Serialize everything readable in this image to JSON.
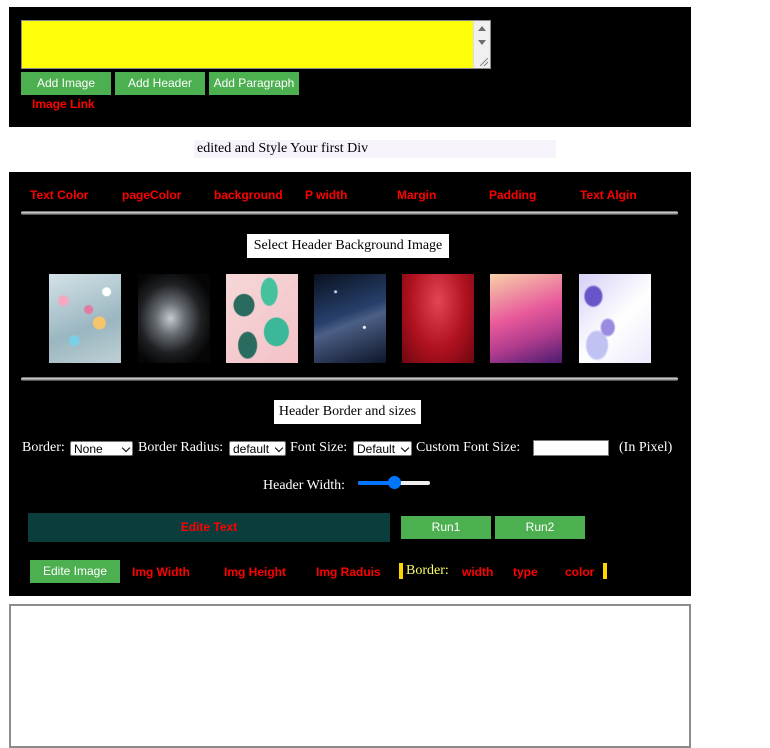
{
  "editor": {
    "buttons": {
      "add_image": "Add Image",
      "add_header": "Add Header",
      "add_paragraph": "Add Paragraph"
    },
    "image_link": "Image Link",
    "textarea_value": ""
  },
  "caption": "edited and Style Your first Div",
  "style_menu": [
    "Text Color",
    "pageColor",
    "background",
    "P width",
    "Margin",
    "Padding",
    "Text Algin"
  ],
  "header_bg": {
    "title": "Select Header Background Image",
    "thumbnails": [
      {
        "name": "bokeh-thumbnail",
        "colors": [
          "#c7d9df",
          "#9fb9c4",
          "#e8b3c6",
          "#7ea6b0"
        ]
      },
      {
        "name": "smoke-thumbnail",
        "colors": [
          "#0a0a0a",
          "#3b3f45",
          "#b7bcc1",
          "#1a1a1a"
        ]
      },
      {
        "name": "leaves-thumbnail",
        "colors": [
          "#f3c2c8",
          "#3bb897",
          "#2a6b5f",
          "#f6d7d7"
        ]
      },
      {
        "name": "galaxy-thumbnail",
        "colors": [
          "#0d1528",
          "#27406b",
          "#4c5f86",
          "#0a1020"
        ]
      },
      {
        "name": "red-thumbnail",
        "colors": [
          "#b0111f",
          "#d93240",
          "#6d0710",
          "#e44555"
        ]
      },
      {
        "name": "pink-gradient-thumbnail",
        "colors": [
          "#f7d0a8",
          "#e85a9b",
          "#b23c8e",
          "#4a1c6f"
        ]
      },
      {
        "name": "floral-thumbnail",
        "colors": [
          "#ffffff",
          "#c0c3f1",
          "#6a54c9",
          "#ece9fb"
        ]
      }
    ]
  },
  "border_section": {
    "title": "Header Border and sizes",
    "border_label": "Border:",
    "border_value": "None",
    "radius_label": "Border Radius:",
    "radius_value": "default",
    "font_size_label": "Font Size:",
    "font_size_value": "Default",
    "custom_font_label": "Custom Font Size:",
    "custom_font_value": "",
    "pixel_note": "(In Pixel)",
    "width_label": "Header Width:",
    "width_value_fraction": 0.5
  },
  "actions": {
    "edit_text": "Edite Text",
    "run1": "Run1",
    "run2": "Run2"
  },
  "image_controls": {
    "edit_image": "Edite Image",
    "img_width": "Img Width",
    "img_height": "Img Height",
    "img_radius": "Img Raduis",
    "border_label": "Border:",
    "width": "width",
    "type": "type",
    "color": "color"
  },
  "colors": {
    "accent_green": "#4caf50",
    "label_red": "#ff0000",
    "highlight_yellow": "#ffff0a",
    "panel_bg": "#000000",
    "slider_blue": "#0075ff"
  }
}
